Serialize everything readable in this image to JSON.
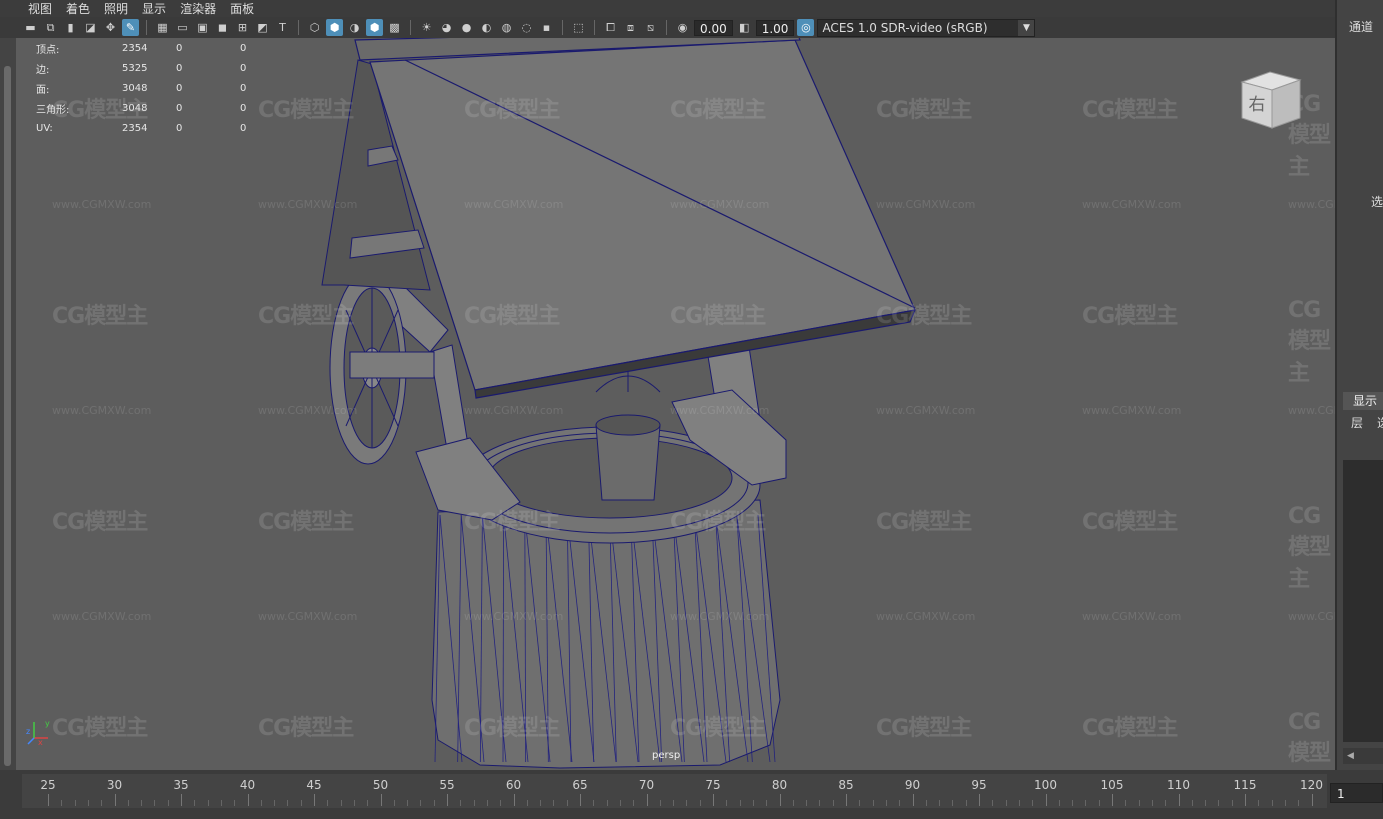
{
  "menu": [
    "视图",
    "着色",
    "照明",
    "显示",
    "渲染器",
    "面板"
  ],
  "toolbar": {
    "exposure": "0.00",
    "gamma": "1.00",
    "color_space": "ACES 1.0 SDR-video (sRGB)"
  },
  "hud": {
    "rows": [
      {
        "label": "顶点:",
        "v1": "2354",
        "v2": "0",
        "v3": "0"
      },
      {
        "label": "边:",
        "v1": "5325",
        "v2": "0",
        "v3": "0"
      },
      {
        "label": "面:",
        "v1": "3048",
        "v2": "0",
        "v3": "0"
      },
      {
        "label": "三角形:",
        "v1": "3048",
        "v2": "0",
        "v3": "0"
      },
      {
        "label": "UV:",
        "v1": "2354",
        "v2": "0",
        "v3": "0"
      }
    ]
  },
  "viewcube": {
    "face_label": "右"
  },
  "camera_label": "persp",
  "axis": {
    "x": "x",
    "y": "y",
    "z": "z"
  },
  "watermark": {
    "logo": "CG模型主",
    "url": "www.CGMXW.com"
  },
  "right_panel": {
    "channels": "通道",
    "select": "选",
    "display_tab": "显示",
    "layer": "层",
    "layer2": "选"
  },
  "timeline": {
    "ticks": [
      "25",
      "30",
      "35",
      "40",
      "45",
      "50",
      "55",
      "60",
      "65",
      "70",
      "75",
      "80",
      "85",
      "90",
      "95",
      "100",
      "105",
      "110",
      "115",
      "120"
    ],
    "current_frame": "1"
  }
}
